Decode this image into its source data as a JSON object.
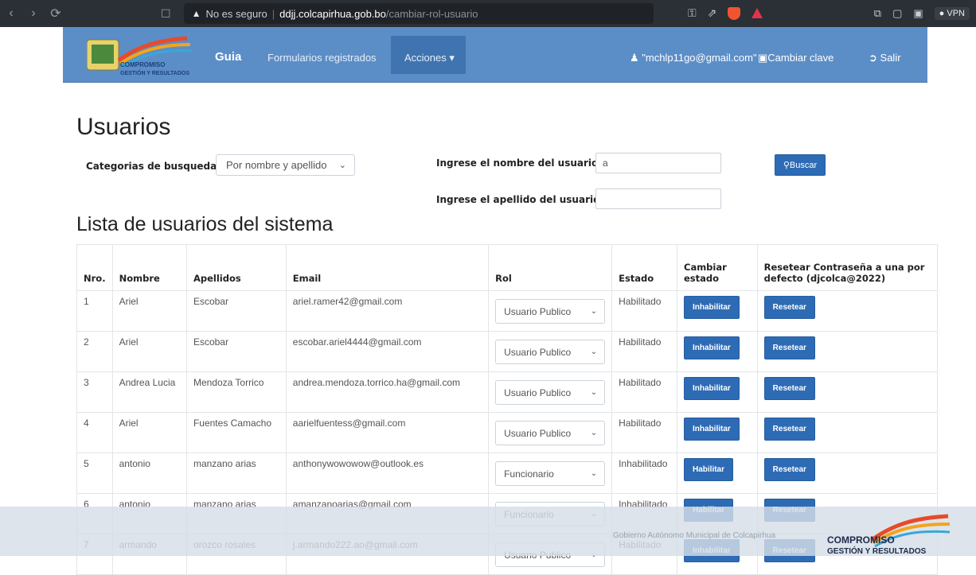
{
  "browser": {
    "insecure_label": "No es seguro",
    "url_host": "ddjj.colcapirhua.gob.bo",
    "url_path": "/cambiar-rol-usuario",
    "vpn_label": "VPN"
  },
  "navbar": {
    "logo_line1": "COMPROMISO",
    "logo_line2": "GESTIÓN Y RESULTADOS",
    "brand": "Guia",
    "items": [
      "Formularios registrados",
      "Acciones ▾"
    ],
    "user": "\"mchlp11go@gmail.com\"",
    "change_password": "Cambiar clave",
    "logout": "Salir"
  },
  "page": {
    "title": "Usuarios",
    "search_category_label": "Categorias de busqueda:",
    "search_category_value": "Por nombre y apellido",
    "name_label": "Ingrese el nombre del usuario:",
    "name_value": "a",
    "lastname_label": "Ingrese el apellido del usuario:",
    "lastname_value": "",
    "search_button": "Buscar",
    "list_title": "Lista de usuarios del sistema"
  },
  "table": {
    "headers": [
      "Nro.",
      "Nombre",
      "Apellidos",
      "Email",
      "Rol",
      "Estado",
      "Cambiar estado",
      "Resetear Contraseña a una por defecto (djcolca@2022)"
    ],
    "rows": [
      {
        "nro": "1",
        "nombre": "Ariel",
        "apellidos": "Escobar",
        "email": "ariel.ramer42@gmail.com",
        "rol": "Usuario Publico",
        "estado": "Habilitado",
        "accion": "Inhabilitar",
        "reset": "Resetear"
      },
      {
        "nro": "2",
        "nombre": "Ariel",
        "apellidos": "Escobar",
        "email": "escobar.ariel4444@gmail.com",
        "rol": "Usuario Publico",
        "estado": "Habilitado",
        "accion": "Inhabilitar",
        "reset": "Resetear"
      },
      {
        "nro": "3",
        "nombre": "Andrea Lucia",
        "apellidos": "Mendoza Torrico",
        "email": "andrea.mendoza.torrico.ha@gmail.com",
        "rol": "Usuario Publico",
        "estado": "Habilitado",
        "accion": "Inhabilitar",
        "reset": "Resetear"
      },
      {
        "nro": "4",
        "nombre": "Ariel",
        "apellidos": "Fuentes Camacho",
        "email": "aarielfuentess@gmail.com",
        "rol": "Usuario Publico",
        "estado": "Habilitado",
        "accion": "Inhabilitar",
        "reset": "Resetear"
      },
      {
        "nro": "5",
        "nombre": "antonio",
        "apellidos": "manzano arias",
        "email": "anthonywowowow@outlook.es",
        "rol": "Funcionario",
        "estado": "Inhabilitado",
        "accion": "Habilitar",
        "reset": "Resetear"
      },
      {
        "nro": "6",
        "nombre": "antonio",
        "apellidos": "manzano arias",
        "email": "amanzanoarias@gmail.com",
        "rol": "Funcionario",
        "estado": "Inhabilitado",
        "accion": "Habilitar",
        "reset": "Resetear"
      },
      {
        "nro": "7",
        "nombre": "armando",
        "apellidos": "orozco rosales",
        "email": "j.armando222.ao@gmail.com",
        "rol": "Usuario Publico",
        "estado": "Habilitado",
        "accion": "Inhabilitar",
        "reset": "Resetear"
      }
    ]
  },
  "footer": {
    "text": "Gobierno Autónomo Municipal de Colcapirhua",
    "logo_line1": "COMPROMISO",
    "logo_line2": "GESTIÓN Y RESULTADOS"
  },
  "colors": {
    "navbar": "#5b8ec7",
    "navbar_active": "#3f74b1",
    "button": "#2d6bb5"
  }
}
